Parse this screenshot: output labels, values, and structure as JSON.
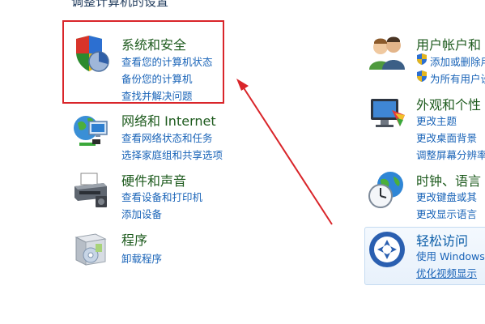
{
  "page": {
    "title": "调整计算机的设置"
  },
  "categories": {
    "system_security": {
      "title": "系统和安全",
      "links": [
        "查看您的计算机状态",
        "备份您的计算机",
        "查找并解决问题"
      ]
    },
    "network": {
      "title": "网络和 Internet",
      "links": [
        "查看网络状态和任务",
        "选择家庭组和共享选项"
      ]
    },
    "hardware": {
      "title": "硬件和声音",
      "links": [
        "查看设备和打印机",
        "添加设备"
      ]
    },
    "programs": {
      "title": "程序",
      "links": [
        "卸载程序"
      ]
    },
    "user_accounts": {
      "title": "用户帐户和",
      "links": [
        "添加或删除用",
        "为所有用户设"
      ]
    },
    "appearance": {
      "title": "外观和个性",
      "links": [
        "更改主题",
        "更改桌面背景",
        "调整屏幕分辨率"
      ]
    },
    "clock": {
      "title": "时钟、语言",
      "links": [
        "更改键盘或其",
        "更改显示语言"
      ]
    },
    "ease": {
      "title": "轻松访问",
      "links": [
        "使用 Windows",
        "优化视频显示"
      ]
    }
  },
  "colors": {
    "highlight": "#d9252a",
    "link": "#1a64b8",
    "category_title": "#1e5b1e"
  }
}
